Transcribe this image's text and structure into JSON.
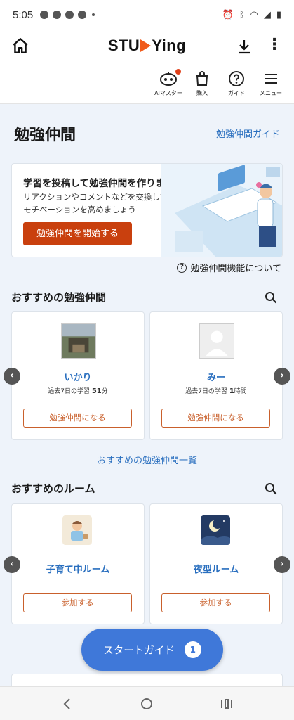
{
  "status_bar": {
    "time": "5:05"
  },
  "top_bar": {
    "logo_text_left": "STU",
    "logo_text_right": "Ying"
  },
  "toolbar": {
    "items": [
      {
        "label": "AIマスター",
        "icon": "robot-icon"
      },
      {
        "label": "購入",
        "icon": "shopping-bag-icon"
      },
      {
        "label": "ガイド",
        "icon": "help-icon"
      },
      {
        "label": "メニュー",
        "icon": "menu-icon"
      }
    ]
  },
  "page": {
    "title": "勉強仲間",
    "guide_link": "勉強仲間ガイド"
  },
  "promo": {
    "heading": "学習を投稿して勉強仲間を作りましょう",
    "sub_line1": "リアクションやコメントなどを交換して",
    "sub_line2": "モチベーションを高めましょう",
    "button": "勉強仲間を開始する"
  },
  "about_link": "勉強仲間機能について",
  "recommended_friends": {
    "title": "おすすめの勉強仲間",
    "cards": [
      {
        "name": "いかり",
        "stat_label": "過去7日の学習",
        "stat_value": "51",
        "stat_unit": "分",
        "button": "勉強仲間になる"
      },
      {
        "name": "みー",
        "stat_label": "過去7日の学習",
        "stat_value": "1",
        "stat_unit": "時間",
        "button": "勉強仲間になる"
      }
    ],
    "list_link": "おすすめの勉強仲間一覧"
  },
  "recommended_rooms": {
    "title": "おすすめのルーム",
    "cards": [
      {
        "name": "子育て中ルーム",
        "button": "参加する"
      },
      {
        "name": "夜型ルーム",
        "button": "参加する"
      }
    ]
  },
  "fab": {
    "label": "スタートガイド",
    "count": "1"
  },
  "colors": {
    "accent": "#c9400e",
    "link": "#2a6fbf",
    "fab": "#3f78d9"
  }
}
